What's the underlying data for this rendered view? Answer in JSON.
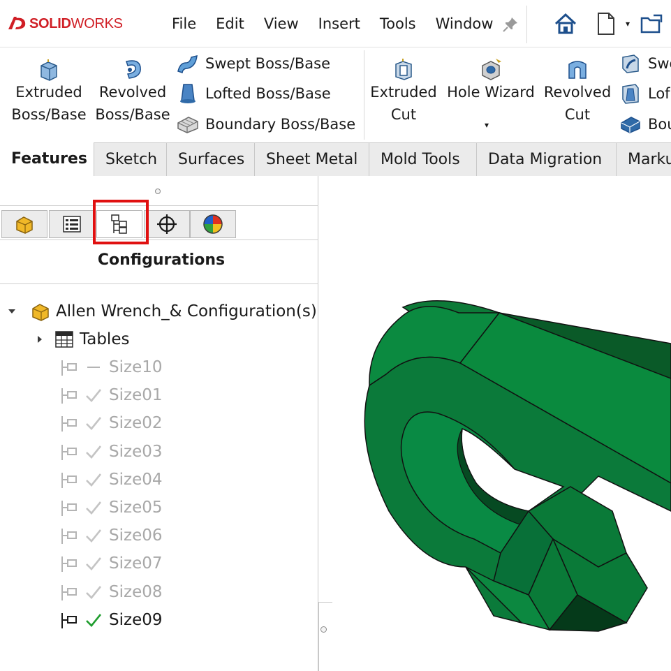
{
  "app": {
    "brand_bold": "SOLID",
    "brand_thin": "WORKS",
    "menu": [
      "File",
      "Edit",
      "View",
      "Insert",
      "Tools",
      "Window"
    ]
  },
  "quick_access": {
    "icons": [
      "home-icon",
      "new-document-icon",
      "open-folder-icon"
    ]
  },
  "command_manager": {
    "large_buttons": [
      {
        "label": "Extruded\nBoss/Base",
        "icon": "extruded-boss-icon"
      },
      {
        "label": "Revolved\nBoss/Base",
        "icon": "revolved-boss-icon"
      },
      {
        "label": "Extruded\nCut",
        "icon": "extruded-cut-icon"
      },
      {
        "label": "Hole Wizard",
        "icon": "hole-wizard-icon"
      },
      {
        "label": "Revolved\nCut",
        "icon": "revolved-cut-icon"
      }
    ],
    "small_buttons_left": [
      {
        "label": "Swept Boss/Base",
        "icon": "swept-boss-icon"
      },
      {
        "label": "Lofted Boss/Base",
        "icon": "lofted-boss-icon"
      },
      {
        "label": "Boundary Boss/Base",
        "icon": "boundary-boss-icon"
      }
    ],
    "small_buttons_right": [
      {
        "label": "Swe",
        "icon": "swept-cut-icon"
      },
      {
        "label": "Lof",
        "icon": "lofted-cut-icon"
      },
      {
        "label": "Bou",
        "icon": "boundary-cut-icon"
      }
    ]
  },
  "tabs": [
    "Features",
    "Sketch",
    "Surfaces",
    "Sheet Metal",
    "Mold Tools",
    "Data Migration",
    "Marku"
  ],
  "active_tab": "Features",
  "panel": {
    "title": "Configurations",
    "tabs": [
      "feature-manager-icon",
      "property-manager-icon",
      "configuration-manager-icon",
      "dim-xpert-icon",
      "display-manager-icon"
    ],
    "active_tab_index": 2
  },
  "tree": {
    "root": "Allen Wrench_& Configuration(s)",
    "tables": "Tables",
    "configurations": [
      {
        "name": "Size10",
        "status": "dash",
        "active": false
      },
      {
        "name": "Size01",
        "status": "check",
        "active": false
      },
      {
        "name": "Size02",
        "status": "check",
        "active": false
      },
      {
        "name": "Size03",
        "status": "check",
        "active": false
      },
      {
        "name": "Size04",
        "status": "check",
        "active": false
      },
      {
        "name": "Size05",
        "status": "check",
        "active": false
      },
      {
        "name": "Size06",
        "status": "check",
        "active": false
      },
      {
        "name": "Size07",
        "status": "check",
        "active": false
      },
      {
        "name": "Size08",
        "status": "check",
        "active": false
      },
      {
        "name": "Size09",
        "status": "check",
        "active": true
      }
    ]
  },
  "colors": {
    "brand_red": "#d01f26",
    "highlight_red": "#e01010",
    "active_check": "#1f9d2e",
    "part_green": "#128a42"
  }
}
